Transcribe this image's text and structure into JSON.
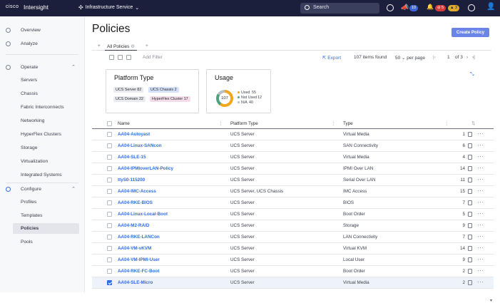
{
  "topbar": {
    "brand": "cisco",
    "app": "Intersight",
    "service": "Infrastructure Service",
    "search": "Search",
    "notif_count": "10",
    "alert_red": "5",
    "alert_yellow": "3",
    "colors": {
      "bg": "#1c1f3b",
      "red": "#d63b3b",
      "yellow": "#e0a82e",
      "blue": "#3f64d8"
    }
  },
  "sidebar": {
    "top": [
      {
        "label": "Overview",
        "icon": "overview-icon"
      },
      {
        "label": "Analyze",
        "icon": "analyze-icon"
      }
    ],
    "operate": {
      "label": "Operate",
      "icon": "operate-icon",
      "items": [
        "Servers",
        "Chassis",
        "Fabric Interconnects",
        "Networking",
        "HyperFlex Clusters",
        "Storage",
        "Virtualization",
        "Integrated Systems"
      ]
    },
    "configure": {
      "label": "Configure",
      "icon": "configure-icon",
      "items": [
        "Profiles",
        "Templates",
        "Policies",
        "Pools"
      ],
      "active": "Policies"
    }
  },
  "page": {
    "title": "Policies",
    "create_button": "Create Policy",
    "tab": "All Policies",
    "filter_placeholder": "Add Filter",
    "export": "Export",
    "items_found": "107 items found",
    "per_page_value": "50",
    "per_page_label": "per page",
    "page_current": "1",
    "page_total_label": "of 3"
  },
  "cards": {
    "platform": {
      "title": "Platform Type",
      "chips": [
        {
          "label": "UCS Server",
          "count": "82"
        },
        {
          "label": "UCS Chassis",
          "count": "2"
        },
        {
          "label": "UCS Domain",
          "count": "22"
        },
        {
          "label": "HyperFlex Cluster",
          "count": "17"
        }
      ]
    },
    "usage": {
      "title": "Usage",
      "total": "107",
      "legend": [
        {
          "label": "Used",
          "value": "55",
          "color": "#f0a71c"
        },
        {
          "label": "Not Used",
          "value": "12",
          "color": "#4aa37c"
        },
        {
          "label": "N/A",
          "value": "40",
          "color": "#b9bdc6"
        }
      ]
    }
  },
  "table": {
    "headers": {
      "name": "Name",
      "platform": "Platform Type",
      "type": "Type"
    },
    "rows": [
      {
        "name": "AA04-Autoyast",
        "platform": "UCS Server",
        "type": "Virtual Media",
        "count": "1"
      },
      {
        "name": "AA04-Linux-SANcon",
        "platform": "UCS Server",
        "type": "SAN Connectivity",
        "count": "6"
      },
      {
        "name": "AA04-SLE-15",
        "platform": "UCS Server",
        "type": "Virtual Media",
        "count": "4"
      },
      {
        "name": "AA04-IPMIoverLAN-Policy",
        "platform": "UCS Server",
        "type": "IPMI Over LAN",
        "count": "14"
      },
      {
        "name": "ttyS0-115200",
        "platform": "UCS Server",
        "type": "Serial Over LAN",
        "count": "11"
      },
      {
        "name": "AA04-IMC-Access",
        "platform": "UCS Server, UCS Chassis",
        "type": "IMC Access",
        "count": "15"
      },
      {
        "name": "AA04-RKE-BIOS",
        "platform": "UCS Server",
        "type": "BIOS",
        "count": "7"
      },
      {
        "name": "AA04-Linux-Local-Boot",
        "platform": "UCS Server",
        "type": "Boot Order",
        "count": "5"
      },
      {
        "name": "AA04-M2-RAID",
        "platform": "UCS Server",
        "type": "Storage",
        "count": "9"
      },
      {
        "name": "AA04-RKE-LANCon",
        "platform": "UCS Server",
        "type": "LAN Connectivity",
        "count": "7"
      },
      {
        "name": "AA04-VM-vKVM",
        "platform": "UCS Server",
        "type": "Virtual KVM",
        "count": "14"
      },
      {
        "name": "AA04-VM-IPMI-User",
        "platform": "UCS Server",
        "type": "Local User",
        "count": "9"
      },
      {
        "name": "AA04-RKE-FC-Boot",
        "platform": "UCS Server",
        "type": "Boot Order",
        "count": "2"
      },
      {
        "name": "AA04-SLE-Micro",
        "platform": "UCS Server",
        "type": "Virtual Media",
        "count": "2",
        "selected": true
      }
    ]
  }
}
